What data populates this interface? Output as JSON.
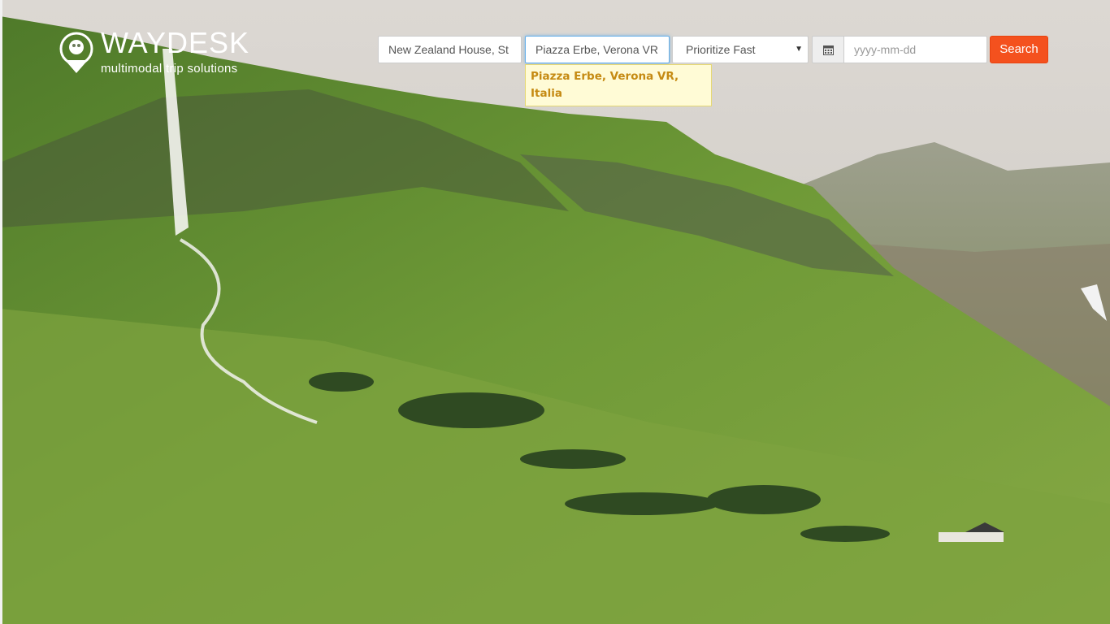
{
  "brand": {
    "name": "WAYDESK",
    "tagline": "multimodal trip solutions"
  },
  "search": {
    "origin_value": "New Zealand House, St",
    "destination_value": "Piazza Erbe, Verona VR",
    "priority_value": "Prioritize Fast",
    "date_placeholder": "yyyy-mm-dd",
    "button_label": "Search"
  },
  "autocomplete": {
    "suggestions": [
      "Piazza Erbe, Verona VR, Italia"
    ]
  },
  "colors": {
    "search_button": "#f4511e",
    "suggestion_bg": "#fffbd6",
    "suggestion_text": "#c58a12"
  }
}
